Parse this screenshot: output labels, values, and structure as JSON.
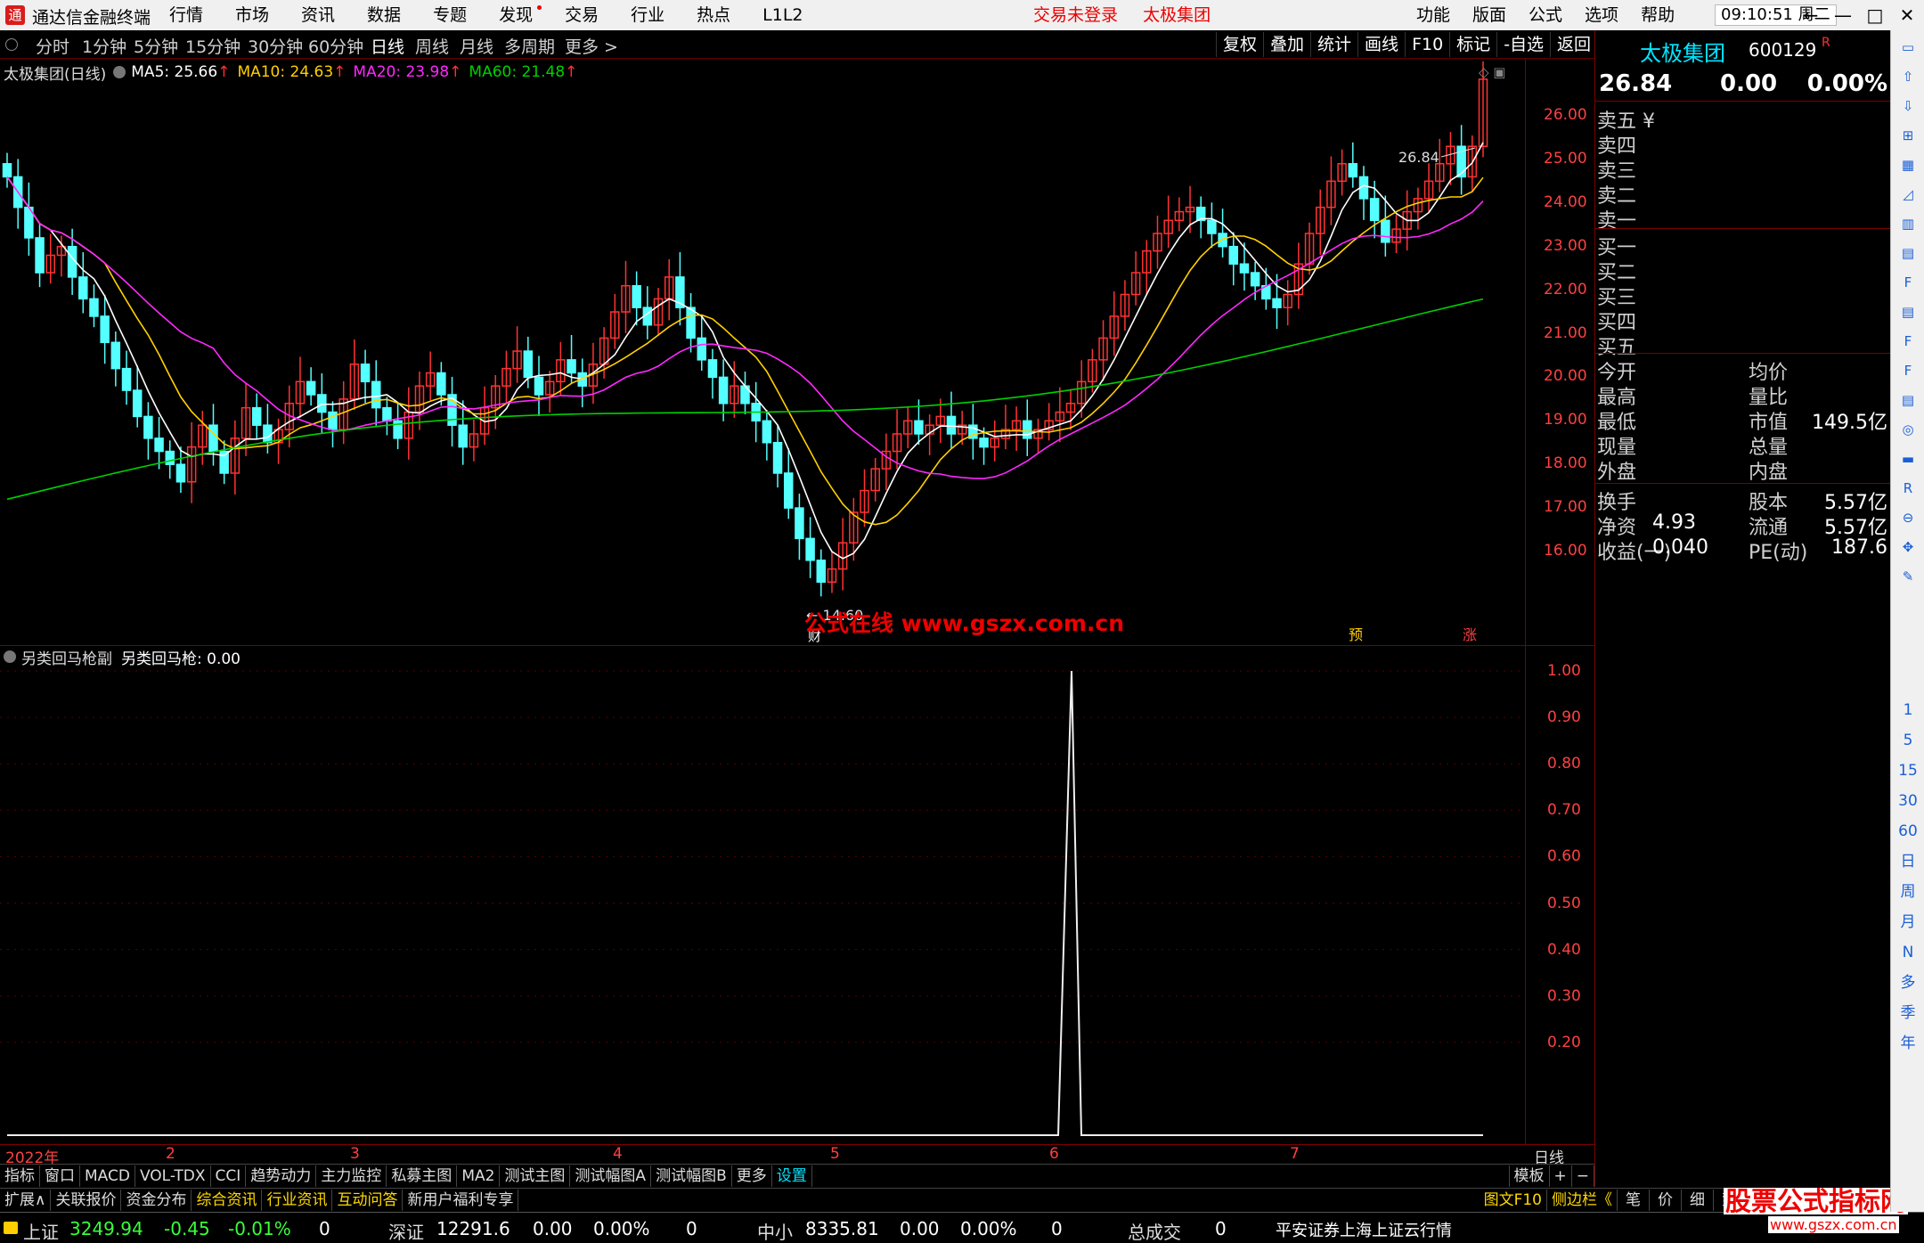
{
  "titlebar": {
    "app_name": "通达信金融终端",
    "menu": [
      "行情",
      "市场",
      "资讯",
      "数据",
      "专题",
      "发现",
      "交易",
      "行业",
      "热点",
      "L1L2"
    ],
    "status": [
      "交易未登录",
      "太极集团"
    ],
    "right_menu": [
      "功能",
      "版面",
      "公式",
      "选项",
      "帮助"
    ],
    "time": "09:10:51",
    "weekday": "周二",
    "controls": [
      "←",
      "—",
      "□",
      "✕"
    ]
  },
  "periods": [
    "分时",
    "1分钟",
    "5分钟",
    "15分钟",
    "30分钟",
    "60分钟",
    "日线",
    "周线",
    "月线",
    "多周期",
    "更多 >"
  ],
  "active_period": "日线",
  "toolbar_right": [
    "复权",
    "叠加",
    "统计",
    "画线",
    "F10",
    "标记",
    "-自选",
    "返回"
  ],
  "ma": {
    "title": "太极集团(日线)",
    "ma5": "MA5: 25.66",
    "ma10": "MA10: 24.63",
    "ma20": "MA20: 23.98",
    "ma60": "MA60: 21.48",
    "arrow": "↑"
  },
  "colors": {
    "ma5": "#ffffff",
    "ma10": "#ffd000",
    "ma20": "#ff28ff",
    "ma60": "#00d000",
    "up": "#ff3232",
    "down": "#54ffff",
    "axis": "#ff4040"
  },
  "main_axis": [
    "26.00",
    "25.00",
    "24.00",
    "23.00",
    "22.00",
    "21.00",
    "20.00",
    "19.00",
    "18.00",
    "17.00",
    "16.00"
  ],
  "main_axis_values": [
    26,
    25,
    24,
    23,
    22,
    21,
    20,
    19,
    18,
    17,
    16
  ],
  "annotations": {
    "high": "26.84",
    "low": "14.60",
    "cai": "财",
    "yu": "预",
    "zhang": "涨"
  },
  "sub": {
    "title1": "另类回马枪副",
    "title2": "另类回马枪: 0.00"
  },
  "sub_axis": [
    "1.00",
    "0.90",
    "0.80",
    "0.70",
    "0.60",
    "0.50",
    "0.40",
    "0.30",
    "0.20"
  ],
  "dates": [
    "2022年",
    "2",
    "3",
    "4",
    "5",
    "6",
    "7"
  ],
  "date_axis_label": "日线",
  "indicator_tabs": [
    "指标",
    "窗口",
    "MACD",
    "VOL-TDX",
    "CCI",
    "趋势动力",
    "主力监控",
    "私募主图",
    "MA2",
    "测试主图",
    "测试幅图A",
    "测试幅图B",
    "更多",
    "设置"
  ],
  "ind_right": [
    "模板",
    "+",
    "−"
  ],
  "bottom_tabs": [
    "扩展∧",
    "关联报价",
    "资金分布",
    "综合资讯",
    "行业资讯",
    "互动问答",
    "新用户福利专享"
  ],
  "bottom_right": [
    "图文F10",
    "侧边栏《",
    "笔",
    "价",
    "细",
    "势"
  ],
  "index_bar": {
    "sh_label": "上证",
    "sh_val": "3249.94",
    "sh_chg": "-0.45",
    "sh_pct": "-0.01%",
    "sh_vol": "0",
    "sz_label": "深证",
    "sz_val": "12291.6",
    "sz_chg": "0.00",
    "sz_pct": "0.00%",
    "sz_vol": "0",
    "zx_label": "中小",
    "zx_val": "8335.81",
    "zx_chg": "0.00",
    "zx_pct": "0.00%",
    "zx_vol": "0",
    "total_label": "总成交",
    "total_val": "0",
    "broker": "平安证券上海上证云行情"
  },
  "quote": {
    "name": "太极集团",
    "code": "600129",
    "r": "R",
    "price": "26.84",
    "chg": "0.00",
    "pct": "0.00%",
    "sell": [
      "卖五",
      "卖四",
      "卖三",
      "卖二",
      "卖一"
    ],
    "sell_unit": "¥",
    "buy": [
      "买一",
      "买二",
      "买三",
      "买四",
      "买五"
    ],
    "stats": [
      [
        "今开",
        "",
        "均价",
        ""
      ],
      [
        "最高",
        "",
        "量比",
        ""
      ],
      [
        "最低",
        "",
        "市值",
        "149.5亿"
      ],
      [
        "现量",
        "",
        "总量",
        ""
      ],
      [
        "外盘",
        "",
        "内盘",
        ""
      ]
    ],
    "stats2": [
      [
        "换手",
        "",
        "股本",
        "5.57亿"
      ],
      [
        "净资",
        "4.93",
        "流通",
        "5.57亿"
      ],
      [
        "收益(一)",
        "0.040",
        "PE(动)",
        "187.6"
      ]
    ]
  },
  "sidebar": [
    "1",
    "5",
    "15",
    "30",
    "60",
    "日",
    "周",
    "月",
    "N",
    "多",
    "季",
    "年"
  ],
  "watermark": "公式在线  www.gszx.com.cn",
  "brand": "股票公式指标网",
  "brand_url": "www.gszx.com.cn"
}
